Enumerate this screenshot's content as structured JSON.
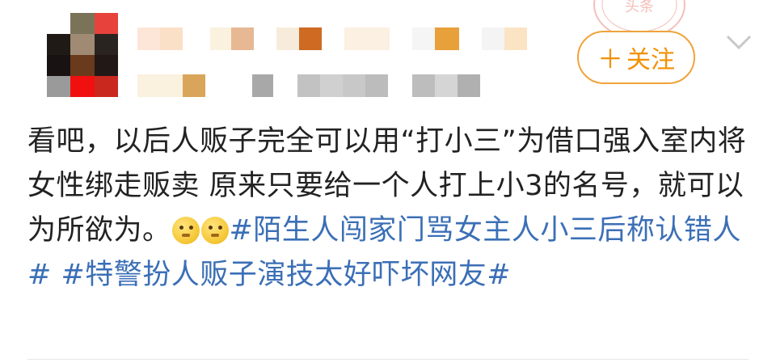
{
  "post": {
    "follow_button": {
      "label": "关注",
      "plus": "＋"
    },
    "text_plain": "看吧，以后人贩子完全可以用“打小三”为借口强入室内将女性绑走贩卖 原来只要给一个人打上小3的名号，就可以为所欲为。",
    "emojis": [
      "thinking-face-icon",
      "thinking-face-icon"
    ],
    "hashtags": [
      "#陌生人闯家门骂女主人小三后称认错人#",
      "#特警扮人贩子演技太好吓坏网友#"
    ],
    "stamp_text": "头条"
  },
  "colors": {
    "follow_accent": "#f29100",
    "hashtag": "#3b6fb6",
    "text": "#222222"
  }
}
